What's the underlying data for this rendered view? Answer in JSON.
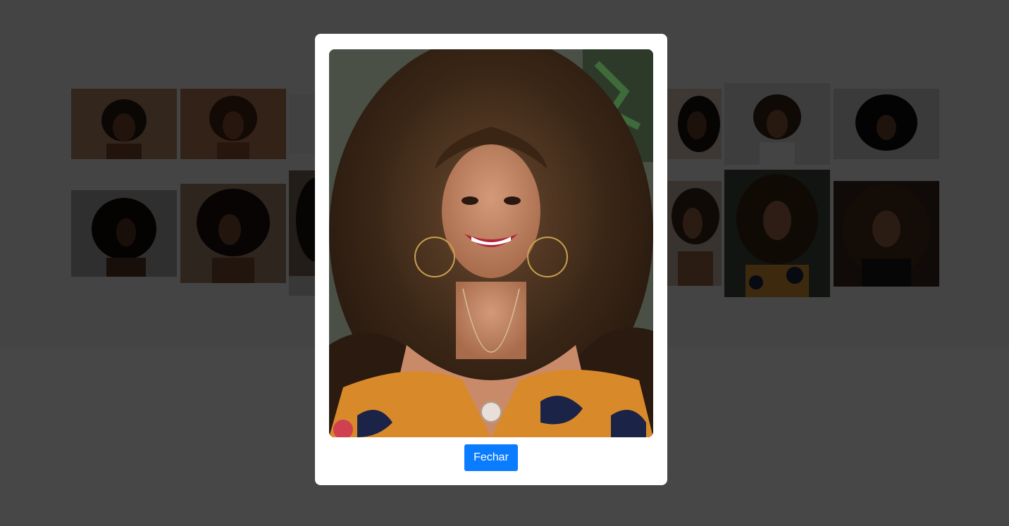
{
  "gallery": {
    "description_items": [
      {
        "id": 1,
        "tone": "#b68a67",
        "hair": "#2a1a12",
        "skin": "#7a4a30"
      },
      {
        "id": 2,
        "tone": "#b57a57",
        "hair": "#4a2414",
        "skin": "#8a5034"
      },
      {
        "id": 3,
        "tone": "#e9e9e9",
        "hair": "#2a1a12",
        "skin": "#8a5a3a"
      },
      {
        "id": 4,
        "tone": "#d9c9b9",
        "hair": "#1a1010",
        "skin": "#6a3e28"
      },
      {
        "id": 5,
        "tone": "#dcdcdc",
        "hair": "#3a2618",
        "skin": "#8e5a3c"
      },
      {
        "id": 6,
        "tone": "#cfcfcf",
        "hair": "#0e0e0e",
        "skin": "#6e4430"
      },
      {
        "id": 7,
        "tone": "#a9a9a9",
        "hair": "#120c0a",
        "skin": "#5c3624"
      },
      {
        "id": 8,
        "tone": "#a48770",
        "hair": "#1a100c",
        "skin": "#7a4c34"
      },
      {
        "id": 9,
        "tone": "#7a6a5a",
        "hair": "#1a120c",
        "skin": "#7a4c34"
      },
      {
        "id": 10,
        "tone": "#c9b6a4",
        "hair": "#3a2416",
        "skin": "#9a6446"
      },
      {
        "id": 11,
        "tone": "#3f4a3a",
        "hair": "#3a2414",
        "skin": "#a06a4a"
      },
      {
        "id": 12,
        "tone": "#3a2a22",
        "hair": "#4a2c18",
        "skin": "#9a6446"
      }
    ]
  },
  "modal": {
    "close_label": "Fechar",
    "accent": "#0a7cff"
  }
}
